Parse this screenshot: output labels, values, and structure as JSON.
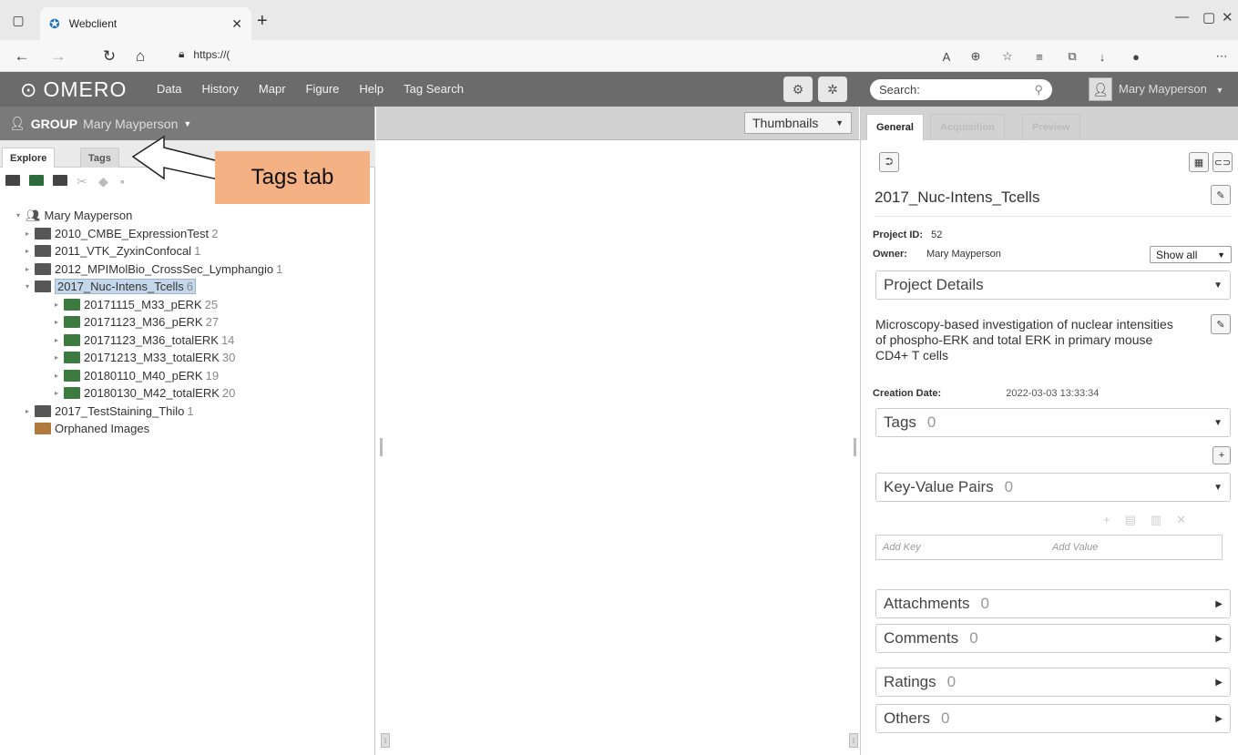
{
  "browser": {
    "tab_title": "Webclient",
    "url": "https://(",
    "nav_icons": [
      "back-icon",
      "forward-icon",
      "reload-icon",
      "home-icon"
    ]
  },
  "omero": {
    "logo_text": "OMERO",
    "nav": [
      "Data",
      "History",
      "Mapr",
      "Figure",
      "Help",
      "Tag Search"
    ],
    "search_placeholder": "Search:",
    "user_name": "Mary Mayperson"
  },
  "left": {
    "group_label": "GROUP",
    "group_user": "Mary Mayperson",
    "tabs": {
      "explore": "Explore",
      "tags": "Tags"
    },
    "tree": [
      {
        "label": "Mary Mayperson",
        "count": ""
      },
      {
        "label": "2010_CMBE_ExpressionTest",
        "count": "2"
      },
      {
        "label": "2011_VTK_ZyxinConfocal",
        "count": "1"
      },
      {
        "label": "2012_MPIMolBio_CrossSec_Lymphangio",
        "count": "1"
      },
      {
        "label": "2017_Nuc-Intens_Tcells",
        "count": "6"
      },
      {
        "label": "20171115_M33_pERK",
        "count": "25"
      },
      {
        "label": "20171123_M36_pERK",
        "count": "27"
      },
      {
        "label": "20171123_M36_totalERK",
        "count": "14"
      },
      {
        "label": "20171213_M33_totalERK",
        "count": "30"
      },
      {
        "label": "20180110_M40_pERK",
        "count": "19"
      },
      {
        "label": "20180130_M42_totalERK",
        "count": "20"
      },
      {
        "label": "2017_TestStaining_Thilo",
        "count": "1"
      },
      {
        "label": "Orphaned Images",
        "count": ""
      }
    ]
  },
  "annotation": {
    "text": "Tags tab"
  },
  "center": {
    "view_select": "Thumbnails"
  },
  "right": {
    "tabs": [
      "General",
      "Acquisition",
      "Preview"
    ],
    "title": "2017_Nuc-Intens_Tcells",
    "project_id_label": "Project ID:",
    "project_id": "52",
    "owner_label": "Owner:",
    "owner": "Mary Mayperson",
    "show_all": "Show all",
    "project_details": "Project Details",
    "description": "Microscopy-based investigation of nuclear intensities of phospho-ERK and total ERK in primary mouse CD4+ T cells",
    "creation_label": "Creation Date:",
    "creation_date": "2022-03-03 13:33:34",
    "sections": {
      "tags": {
        "label": "Tags",
        "count": "0"
      },
      "kv": {
        "label": "Key-Value Pairs",
        "count": "0"
      },
      "attachments": {
        "label": "Attachments",
        "count": "0"
      },
      "comments": {
        "label": "Comments",
        "count": "0"
      },
      "ratings": {
        "label": "Ratings",
        "count": "0"
      },
      "others": {
        "label": "Others",
        "count": "0"
      }
    },
    "add_key": "Add Key",
    "add_value": "Add Value"
  },
  "colors": {
    "header_bg": "#6b6b6b",
    "annotation_bg": "#f4b183",
    "project_folder": "#565656",
    "dataset_folder": "#3d7a3f"
  }
}
